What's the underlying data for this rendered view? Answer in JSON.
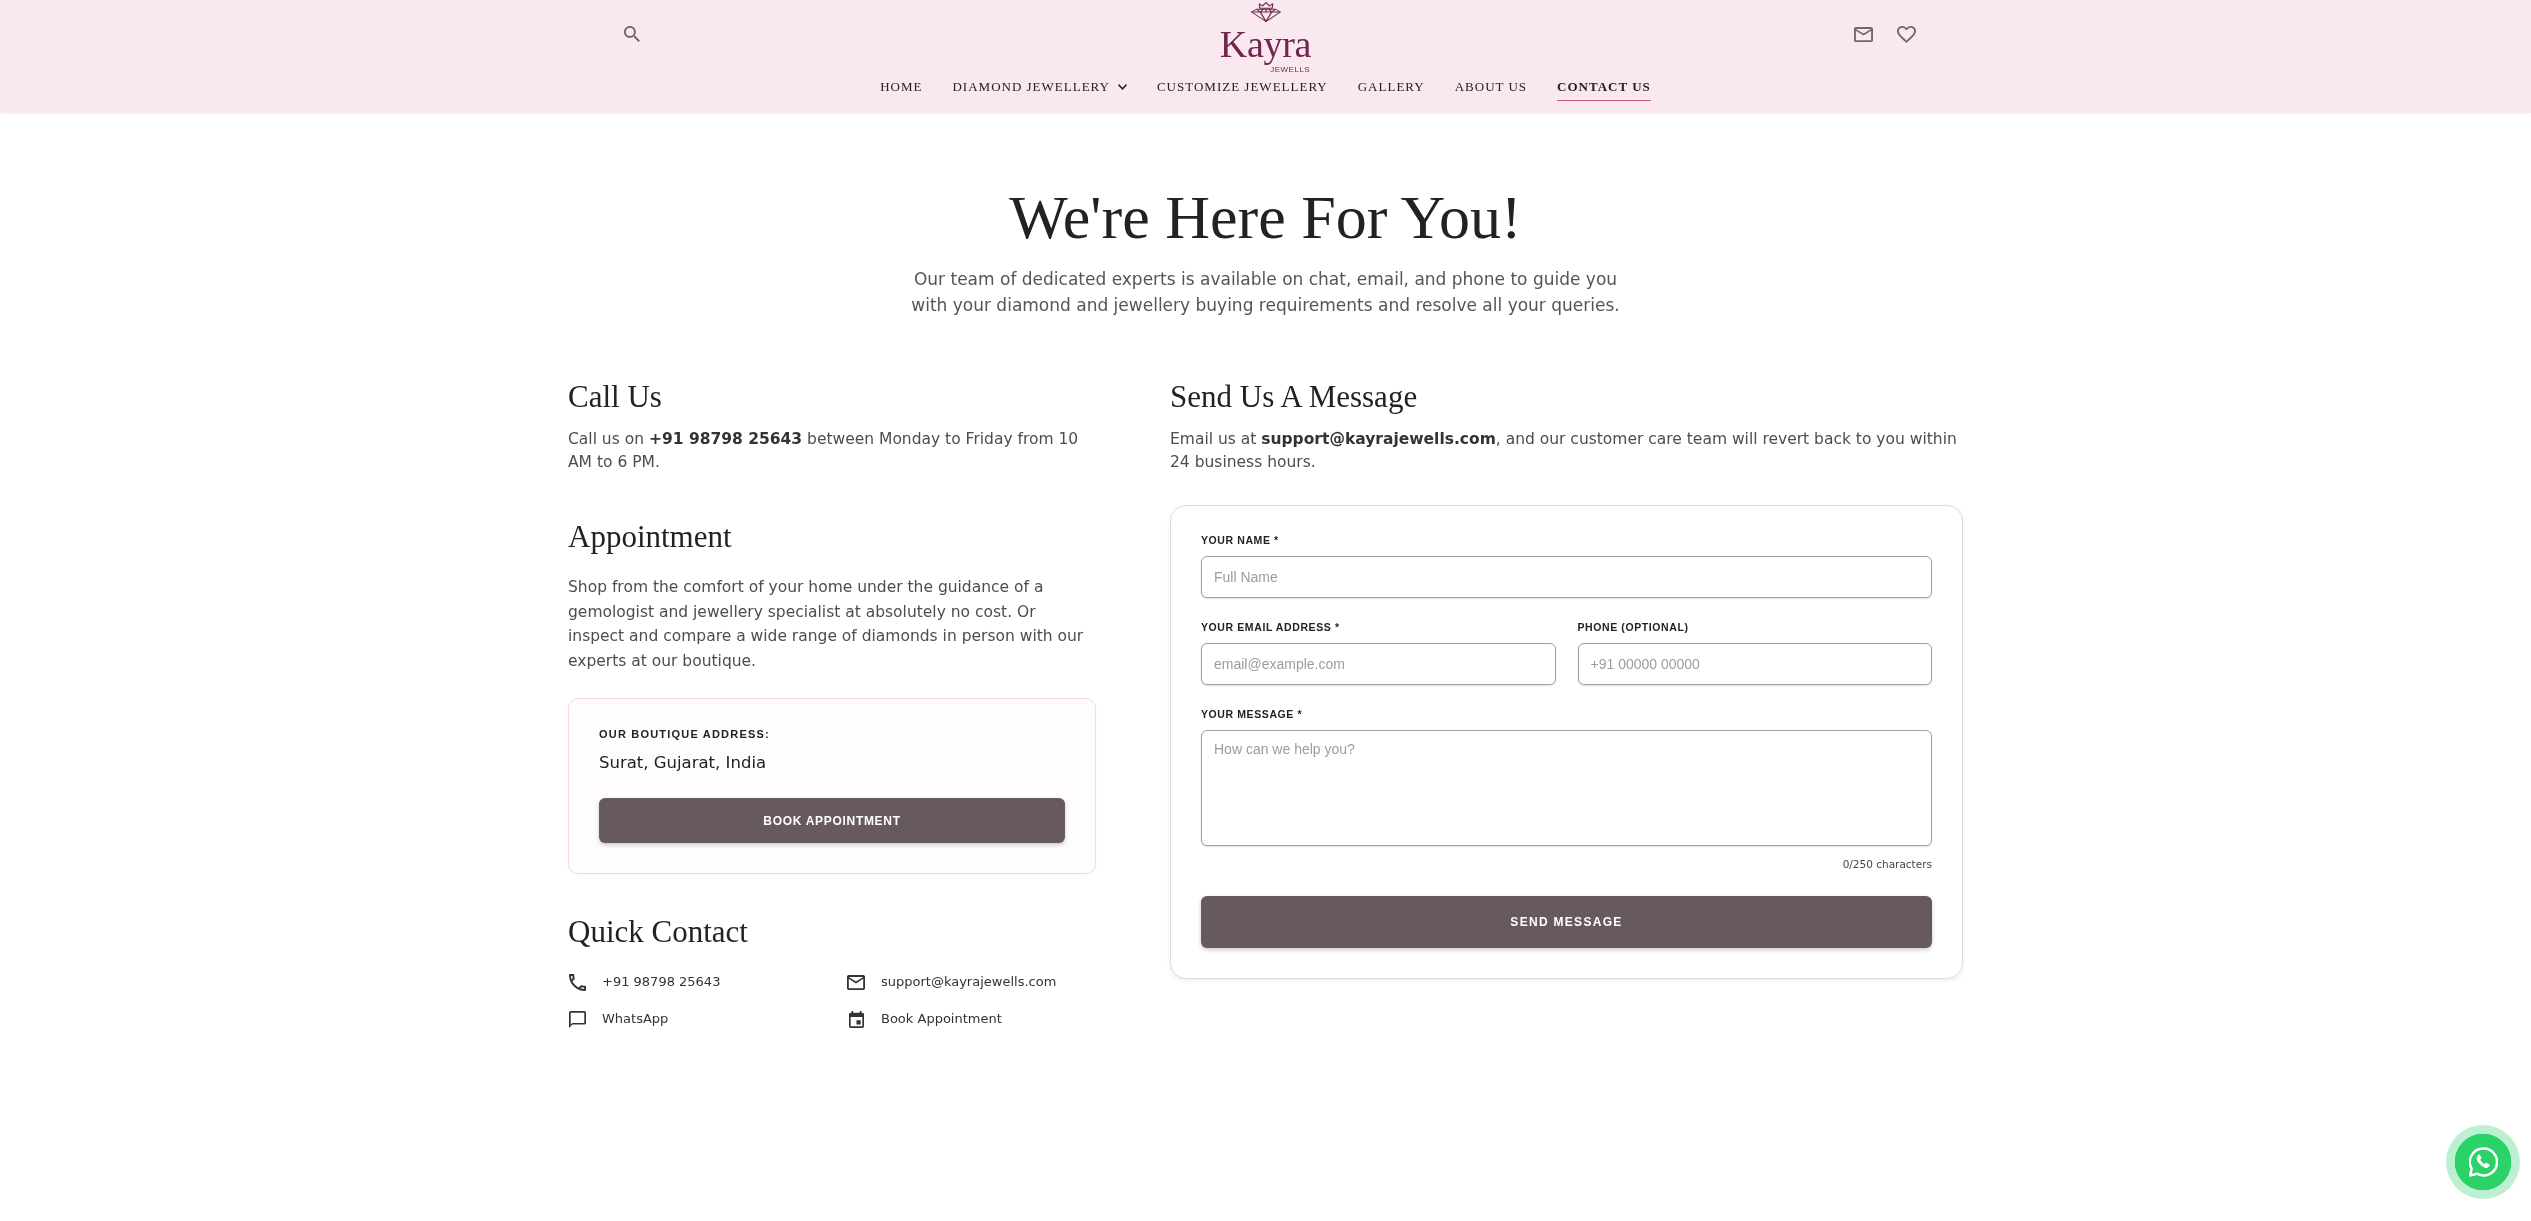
{
  "header": {
    "logo": {
      "name": "Kayra",
      "tagline": "JEWELLS"
    },
    "nav": [
      {
        "label": "HOME",
        "selected": false,
        "dropdown": false
      },
      {
        "label": "DIAMOND JEWELLERY",
        "selected": false,
        "dropdown": true
      },
      {
        "label": "CUSTOMIZE JEWELLERY",
        "selected": false,
        "dropdown": false
      },
      {
        "label": "GALLERY",
        "selected": false,
        "dropdown": false
      },
      {
        "label": "ABOUT US",
        "selected": false,
        "dropdown": false
      },
      {
        "label": "CONTACT US",
        "selected": true,
        "dropdown": false
      }
    ]
  },
  "hero": {
    "title": "We're Here For You!",
    "intro": "Our team of dedicated experts is available on chat, email, and phone to guide you with your diamond and jewellery buying requirements and resolve all your queries."
  },
  "call_us": {
    "heading": "Call Us",
    "text": "Call us on **+91 98798 25643** between Monday to Friday from 10 AM to 6 PM."
  },
  "appointment": {
    "heading": "Appointment",
    "text": "Shop from the comfort of your home under the guidance of a gemologist and jewellery specialist at absolutely no cost. Or inspect and compare a wide range of diamonds in person with our experts at our boutique.",
    "address_card": {
      "label": "OUR BOUTIQUE ADDRESS:",
      "address": "Surat, Gujarat, India",
      "button": "BOOK APPOINTMENT"
    }
  },
  "quick_contact": {
    "heading": "Quick Contact",
    "items": [
      {
        "kind": "phone",
        "label": "+91 98798 25643"
      },
      {
        "kind": "email",
        "label": "support@kayrajewells.com"
      },
      {
        "kind": "chat",
        "label": "WhatsApp"
      },
      {
        "kind": "calendar",
        "label": "Book Appointment"
      }
    ]
  },
  "message": {
    "heading": "Send Us A Message",
    "text": "Email us at **support@kayrajewells.com**, and our customer care team will revert back to you within 24 business hours.",
    "form": {
      "rows": [
        {
          "fields": [
            {
              "kind": "input",
              "label": "YOUR NAME *",
              "placeholder": "Full Name"
            }
          ]
        },
        {
          "fields": [
            {
              "kind": "input",
              "label": "YOUR EMAIL ADDRESS *",
              "placeholder": "email@example.com"
            },
            {
              "kind": "input",
              "label": "PHONE (OPTIONAL)",
              "placeholder": "+91 00000 00000"
            }
          ]
        },
        {
          "fields": [
            {
              "kind": "textarea",
              "label": "YOUR MESSAGE *",
              "placeholder": "How can we help you?",
              "counter": "0/250 characters"
            }
          ]
        }
      ],
      "submit": "SEND MESSAGE"
    }
  }
}
